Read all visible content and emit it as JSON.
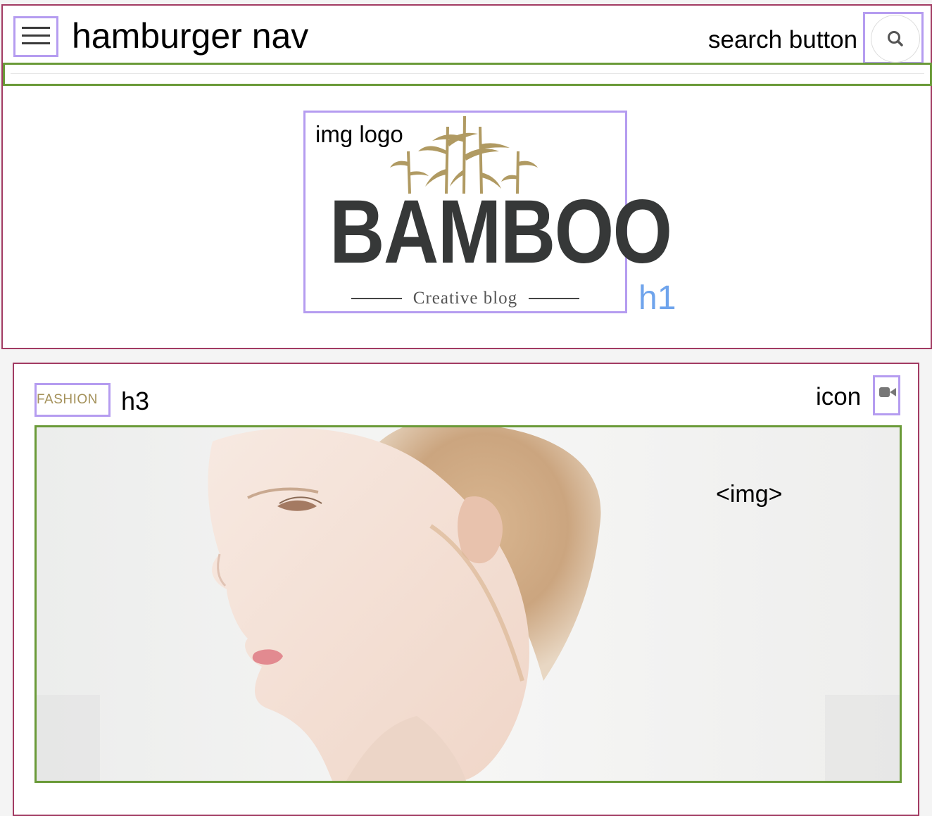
{
  "annotations": {
    "hamburger_label": "hamburger nav",
    "search_label": "search button",
    "img_logo_label": "img logo",
    "h1_label": "h1",
    "h3_label": "h3",
    "icon_label": "icon",
    "img_label": "<img>"
  },
  "logo": {
    "wordmark": "BAMBOO",
    "tagline": "Creative blog"
  },
  "article": {
    "category": "FASHION"
  },
  "icons": {
    "hamburger": "hamburger-menu-icon",
    "search": "search-icon",
    "logo": "bamboo-leaves-icon",
    "format": "video-camera-icon"
  },
  "colors": {
    "section_outline": "#a23b63",
    "element_outline": "#b59cf0",
    "container_outline": "#6a9a38",
    "h1_annotation": "#6fa4ec",
    "accent_gold": "#a4915a",
    "logo_text": "#363838"
  }
}
